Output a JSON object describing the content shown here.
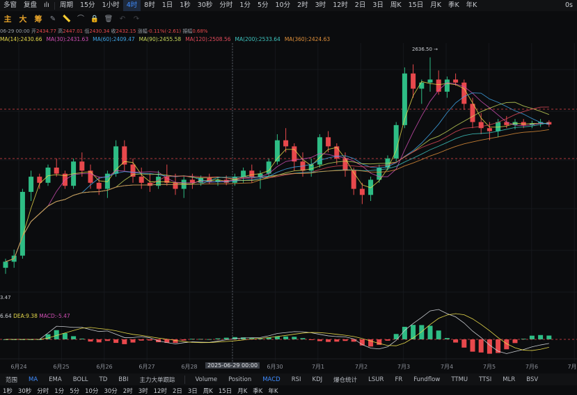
{
  "toolbar": {
    "items": [
      "多窗",
      "复盘",
      "",
      "周期",
      "15分",
      "1小时",
      "4时",
      "8时",
      "1日",
      "1秒",
      "30秒",
      "分时",
      "1分",
      "5分",
      "10分",
      "2时",
      "3时",
      "12时",
      "2日",
      "3日",
      "周K",
      "15日",
      "月K",
      "季K",
      "年K"
    ],
    "right_label": "0s"
  },
  "drawbar": {
    "buttons": [
      "主",
      "大",
      "筹"
    ]
  },
  "ohlc": {
    "date": "06-29 00:00",
    "open_label": "开",
    "open": "2434.77",
    "high_label": "高",
    "high": "2447.01",
    "low_label": "低",
    "low": "2430.34",
    "close_label": "收",
    "close": "2432.15",
    "change_label": "涨幅",
    "change": "-0.11%(-2.61)",
    "amp_label": "振幅",
    "amp": "0.68%"
  },
  "ma_legend": [
    {
      "text": "MA(14):2430.66",
      "color": "#e6d84a"
    },
    {
      "text": "MA(30):2431.63",
      "color": "#d04fb4"
    },
    {
      "text": "MA(60):2409.47",
      "color": "#3fa6e8"
    },
    {
      "text": "MA(90):2455.58",
      "color": "#c8d85a"
    },
    {
      "text": "MA(120):2508.56",
      "color": "#e04a5a"
    },
    {
      "text": "MA(200):2533.64",
      "color": "#3ec6c0"
    },
    {
      "text": "MA(360):2424.63",
      "color": "#e0903a"
    }
  ],
  "annotations": {
    "high": "2636.50",
    "low_partial": "3.47"
  },
  "macd": {
    "dif": "6.64",
    "dea_label": "DEA:",
    "dea": "9.38",
    "macd_label": "MACD:",
    "macd": "-5.47"
  },
  "xaxis": [
    "6月24",
    "6月25",
    "6月26",
    "6月27",
    "6月28",
    "2025-06-29 00:00",
    "6月30",
    "7月1",
    "7月2",
    "7月3",
    "7月4",
    "7月5",
    "7月6",
    "7月"
  ],
  "indicators": [
    "范围",
    "MA",
    "EMA",
    "BOLL",
    "TD",
    "BBI",
    "主力大单跟踪",
    "Volume",
    "Position",
    "MACD",
    "RSI",
    "KDJ",
    "爆仓统计",
    "LSUR",
    "FR",
    "Fundflow",
    "TTMU",
    "TTSI",
    "MLR",
    "BSV"
  ],
  "bottom_periods": [
    "1秒",
    "30秒",
    "分时",
    "1分",
    "5分",
    "10分",
    "30分",
    "2时",
    "3时",
    "12时",
    "2日",
    "3日",
    "周K",
    "15日",
    "月K",
    "季K",
    "年K"
  ],
  "colors": {
    "up": "#2ebd85",
    "down": "#e8484c",
    "accent": "#3f8cff"
  },
  "chart_data": {
    "type": "candlestick",
    "candles": [
      [
        2290,
        2305,
        2280,
        2300
      ],
      [
        2300,
        2320,
        2290,
        2310
      ],
      [
        2310,
        2420,
        2305,
        2415
      ],
      [
        2415,
        2450,
        2400,
        2440
      ],
      [
        2440,
        2445,
        2420,
        2430
      ],
      [
        2430,
        2460,
        2425,
        2455
      ],
      [
        2455,
        2470,
        2440,
        2445
      ],
      [
        2445,
        2450,
        2420,
        2425
      ],
      [
        2425,
        2470,
        2420,
        2465
      ],
      [
        2465,
        2480,
        2440,
        2450
      ],
      [
        2450,
        2460,
        2420,
        2430
      ],
      [
        2430,
        2440,
        2410,
        2420
      ],
      [
        2420,
        2450,
        2405,
        2445
      ],
      [
        2445,
        2500,
        2440,
        2490
      ],
      [
        2490,
        2500,
        2450,
        2460
      ],
      [
        2460,
        2470,
        2430,
        2440
      ],
      [
        2440,
        2455,
        2420,
        2430
      ],
      [
        2430,
        2445,
        2415,
        2425
      ],
      [
        2425,
        2450,
        2420,
        2440
      ],
      [
        2440,
        2460,
        2425,
        2430
      ],
      [
        2430,
        2445,
        2410,
        2420
      ],
      [
        2420,
        2440,
        2405,
        2435
      ],
      [
        2435,
        2445,
        2420,
        2430
      ],
      [
        2430,
        2442,
        2425,
        2438
      ],
      [
        2438,
        2445,
        2428,
        2432
      ],
      [
        2432,
        2440,
        2425,
        2435
      ],
      [
        2435,
        2442,
        2426,
        2430
      ],
      [
        2430,
        2445,
        2425,
        2440
      ],
      [
        2440,
        2455,
        2430,
        2450
      ],
      [
        2450,
        2460,
        2430,
        2440
      ],
      [
        2440,
        2450,
        2420,
        2445
      ],
      [
        2445,
        2470,
        2440,
        2465
      ],
      [
        2465,
        2510,
        2460,
        2500
      ],
      [
        2500,
        2520,
        2480,
        2490
      ],
      [
        2490,
        2495,
        2450,
        2465
      ],
      [
        2465,
        2480,
        2440,
        2450
      ],
      [
        2450,
        2470,
        2440,
        2460
      ],
      [
        2460,
        2510,
        2455,
        2505
      ],
      [
        2505,
        2515,
        2480,
        2490
      ],
      [
        2490,
        2495,
        2460,
        2470
      ],
      [
        2470,
        2480,
        2440,
        2450
      ],
      [
        2450,
        2455,
        2410,
        2420
      ],
      [
        2420,
        2430,
        2395,
        2410
      ],
      [
        2410,
        2440,
        2400,
        2435
      ],
      [
        2435,
        2460,
        2430,
        2455
      ],
      [
        2455,
        2475,
        2450,
        2470
      ],
      [
        2470,
        2530,
        2465,
        2525
      ],
      [
        2525,
        2620,
        2520,
        2610
      ],
      [
        2610,
        2625,
        2570,
        2585
      ],
      [
        2585,
        2600,
        2560,
        2595
      ],
      [
        2595,
        2636.5,
        2580,
        2600
      ],
      [
        2600,
        2615,
        2575,
        2580
      ],
      [
        2580,
        2605,
        2570,
        2600
      ],
      [
        2600,
        2610,
        2590,
        2595
      ],
      [
        2595,
        2600,
        2550,
        2560
      ],
      [
        2560,
        2570,
        2520,
        2530
      ],
      [
        2530,
        2545,
        2510,
        2520
      ],
      [
        2520,
        2530,
        2500,
        2515
      ],
      [
        2515,
        2535,
        2505,
        2530
      ],
      [
        2530,
        2540,
        2520,
        2525
      ],
      [
        2525,
        2535,
        2518,
        2530
      ],
      [
        2530,
        2535,
        2520,
        2525
      ],
      [
        2525,
        2532,
        2520,
        2528
      ],
      [
        2528,
        2535,
        2522,
        2530
      ],
      [
        2530,
        2533,
        2522,
        2526
      ]
    ],
    "y_range": [
      2250,
      2660
    ],
    "moving_averages": [
      "MA(14)",
      "MA(30)",
      "MA(60)",
      "MA(90)",
      "MA(120)",
      "MA(200)",
      "MA(360)"
    ],
    "macd_panel": {
      "dif": 6.64,
      "dea": 9.38,
      "macd": -5.47
    }
  }
}
